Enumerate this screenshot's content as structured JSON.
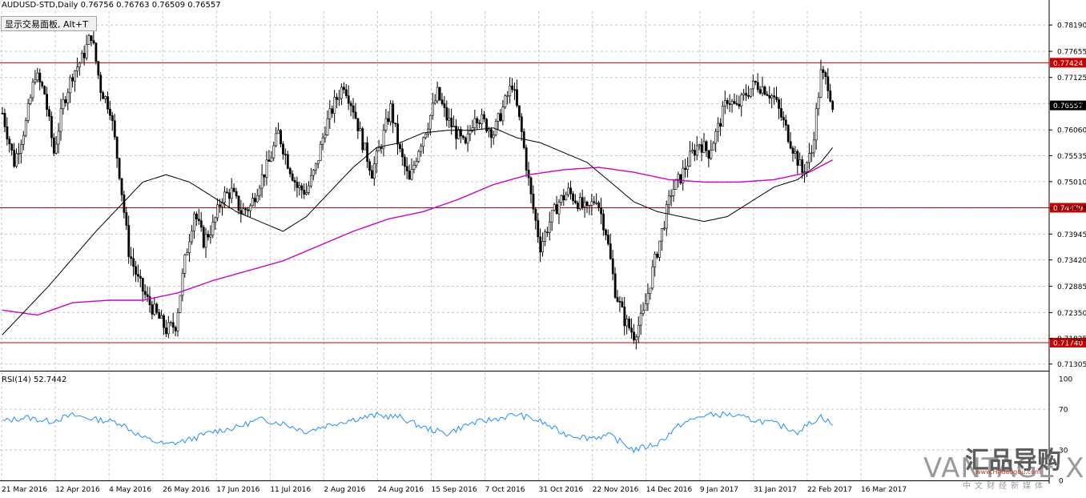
{
  "header": {
    "symbol_line": "AUDUSD-STD,Daily  0.76756 0.76763 0.76509 0.76557",
    "rsi_line": "RSI(14) 52.7442",
    "trade_panel_button": "显示交易面板, Alt+T"
  },
  "watermark": {
    "logo_text": "VANTAGE X",
    "site_text": "汇品导购",
    "site_url": "www.HPdaogou.com",
    "tagline": "中文财经新媒体"
  },
  "colors": {
    "background": "#ffffff",
    "candle": "#000000",
    "ma_short": "#000000",
    "ma_long": "#cc00cc",
    "hline": "#cc0000",
    "rsi": "#1e90ff",
    "grid": "#c8c8c8"
  },
  "chart_data": [
    {
      "type": "candlestick",
      "symbol": "AUDUSD-STD",
      "timeframe": "Daily",
      "ylim": [
        0.7117,
        0.7847
      ],
      "y_ticks": [
        "0.78190",
        "0.77655",
        "0.77125",
        "0.76595",
        "0.76060",
        "0.75535",
        "0.75010",
        "0.74475",
        "0.73945",
        "0.73420",
        "0.72885",
        "0.72350",
        "0.71825",
        "0.71305"
      ],
      "x_ticks": [
        "21 Mar 2016",
        "12 Apr 2016",
        "4 May 2016",
        "26 May 2016",
        "17 Jun 2016",
        "11 Jul 2016",
        "2 Aug 2016",
        "24 Aug 2016",
        "15 Sep 2016",
        "7 Oct 2016",
        "31 Oct 2016",
        "22 Nov 2016",
        "14 Dec 2016",
        "9 Jan 2017",
        "31 Jan 2017",
        "22 Feb 2017",
        "16 Mar 2017"
      ],
      "grid": true,
      "horizontal_lines": [
        {
          "value": 0.77424,
          "label": "0.77424"
        },
        {
          "value": 0.74479,
          "label": "0.74479"
        },
        {
          "value": 0.7174,
          "label": "0.71740"
        }
      ],
      "current_price": {
        "value": 0.76557,
        "label": "0.76557"
      },
      "anchors": [
        [
          0,
          0.764
        ],
        [
          5,
          0.754
        ],
        [
          10,
          0.762
        ],
        [
          14,
          0.772
        ],
        [
          18,
          0.768
        ],
        [
          22,
          0.756
        ],
        [
          26,
          0.766
        ],
        [
          30,
          0.772
        ],
        [
          34,
          0.775
        ],
        [
          38,
          0.78
        ],
        [
          42,
          0.769
        ],
        [
          46,
          0.765
        ],
        [
          50,
          0.752
        ],
        [
          54,
          0.736
        ],
        [
          58,
          0.73
        ],
        [
          62,
          0.726
        ],
        [
          66,
          0.723
        ],
        [
          70,
          0.72
        ],
        [
          74,
          0.721
        ],
        [
          78,
          0.734
        ],
        [
          82,
          0.744
        ],
        [
          86,
          0.738
        ],
        [
          90,
          0.741
        ],
        [
          94,
          0.747
        ],
        [
          98,
          0.748
        ],
        [
          102,
          0.744
        ],
        [
          106,
          0.745
        ],
        [
          110,
          0.75
        ],
        [
          114,
          0.754
        ],
        [
          118,
          0.76
        ],
        [
          122,
          0.754
        ],
        [
          126,
          0.749
        ],
        [
          130,
          0.748
        ],
        [
          134,
          0.753
        ],
        [
          138,
          0.761
        ],
        [
          142,
          0.766
        ],
        [
          146,
          0.77
        ],
        [
          150,
          0.765
        ],
        [
          154,
          0.758
        ],
        [
          158,
          0.752
        ],
        [
          162,
          0.758
        ],
        [
          166,
          0.765
        ],
        [
          170,
          0.756
        ],
        [
          174,
          0.75
        ],
        [
          178,
          0.757
        ],
        [
          182,
          0.762
        ],
        [
          186,
          0.768
        ],
        [
          190,
          0.763
        ],
        [
          194,
          0.76
        ],
        [
          198,
          0.757
        ],
        [
          202,
          0.764
        ],
        [
          206,
          0.762
        ],
        [
          210,
          0.76
        ],
        [
          214,
          0.765
        ],
        [
          218,
          0.77
        ],
        [
          222,
          0.76
        ],
        [
          226,
          0.747
        ],
        [
          230,
          0.737
        ],
        [
          234,
          0.742
        ],
        [
          238,
          0.746
        ],
        [
          242,
          0.748
        ],
        [
          246,
          0.746
        ],
        [
          250,
          0.744
        ],
        [
          254,
          0.747
        ],
        [
          258,
          0.74
        ],
        [
          262,
          0.728
        ],
        [
          266,
          0.722
        ],
        [
          270,
          0.719
        ],
        [
          274,
          0.723
        ],
        [
          278,
          0.732
        ],
        [
          282,
          0.74
        ],
        [
          286,
          0.748
        ],
        [
          290,
          0.751
        ],
        [
          294,
          0.755
        ],
        [
          298,
          0.758
        ],
        [
          302,
          0.756
        ],
        [
          306,
          0.761
        ],
        [
          310,
          0.767
        ],
        [
          314,
          0.765
        ],
        [
          318,
          0.768
        ],
        [
          322,
          0.77
        ],
        [
          326,
          0.769
        ],
        [
          330,
          0.767
        ],
        [
          334,
          0.762
        ],
        [
          338,
          0.757
        ],
        [
          342,
          0.752
        ],
        [
          346,
          0.756
        ],
        [
          350,
          0.772
        ],
        [
          353,
          0.77
        ],
        [
          355,
          0.7656
        ]
      ],
      "ma_short": [
        [
          0,
          0.719
        ],
        [
          20,
          0.729
        ],
        [
          40,
          0.74
        ],
        [
          60,
          0.75
        ],
        [
          70,
          0.7515
        ],
        [
          80,
          0.75
        ],
        [
          90,
          0.747
        ],
        [
          100,
          0.744
        ],
        [
          110,
          0.742
        ],
        [
          120,
          0.74
        ],
        [
          130,
          0.743
        ],
        [
          140,
          0.748
        ],
        [
          150,
          0.753
        ],
        [
          160,
          0.757
        ],
        [
          170,
          0.758
        ],
        [
          180,
          0.76
        ],
        [
          190,
          0.7605
        ],
        [
          200,
          0.7605
        ],
        [
          210,
          0.761
        ],
        [
          220,
          0.759
        ],
        [
          230,
          0.758
        ],
        [
          240,
          0.756
        ],
        [
          250,
          0.754
        ],
        [
          260,
          0.75
        ],
        [
          270,
          0.746
        ],
        [
          280,
          0.744
        ],
        [
          290,
          0.743
        ],
        [
          300,
          0.742
        ],
        [
          310,
          0.743
        ],
        [
          320,
          0.746
        ],
        [
          330,
          0.749
        ],
        [
          340,
          0.7505
        ],
        [
          350,
          0.754
        ],
        [
          355,
          0.757
        ]
      ],
      "ma_long": [
        [
          0,
          0.724
        ],
        [
          15,
          0.723
        ],
        [
          30,
          0.7255
        ],
        [
          45,
          0.726
        ],
        [
          60,
          0.726
        ],
        [
          75,
          0.7275
        ],
        [
          90,
          0.73
        ],
        [
          105,
          0.732
        ],
        [
          120,
          0.734
        ],
        [
          135,
          0.737
        ],
        [
          150,
          0.74
        ],
        [
          165,
          0.7425
        ],
        [
          180,
          0.744
        ],
        [
          195,
          0.7465
        ],
        [
          210,
          0.7495
        ],
        [
          225,
          0.7515
        ],
        [
          240,
          0.7525
        ],
        [
          255,
          0.753
        ],
        [
          270,
          0.752
        ],
        [
          285,
          0.7505
        ],
        [
          300,
          0.75
        ],
        [
          315,
          0.75
        ],
        [
          330,
          0.7505
        ],
        [
          345,
          0.752
        ],
        [
          355,
          0.7545
        ]
      ]
    },
    {
      "type": "line",
      "name": "RSI(14)",
      "last_value": 52.7442,
      "ylim": [
        0,
        100
      ],
      "y_ticks": [
        "100",
        "70",
        "30",
        "0"
      ],
      "x": [
        0,
        10,
        20,
        30,
        40,
        50,
        60,
        70,
        80,
        90,
        100,
        110,
        120,
        130,
        140,
        150,
        160,
        170,
        180,
        190,
        200,
        210,
        220,
        230,
        240,
        250,
        260,
        270,
        280,
        290,
        300,
        310,
        320,
        330,
        340,
        350,
        355
      ],
      "values": [
        58,
        62,
        58,
        64,
        60,
        57,
        42,
        35,
        40,
        48,
        52,
        60,
        56,
        48,
        55,
        60,
        64,
        62,
        52,
        46,
        56,
        60,
        65,
        58,
        46,
        42,
        44,
        30,
        36,
        55,
        64,
        65,
        60,
        56,
        48,
        63,
        55
      ]
    }
  ]
}
